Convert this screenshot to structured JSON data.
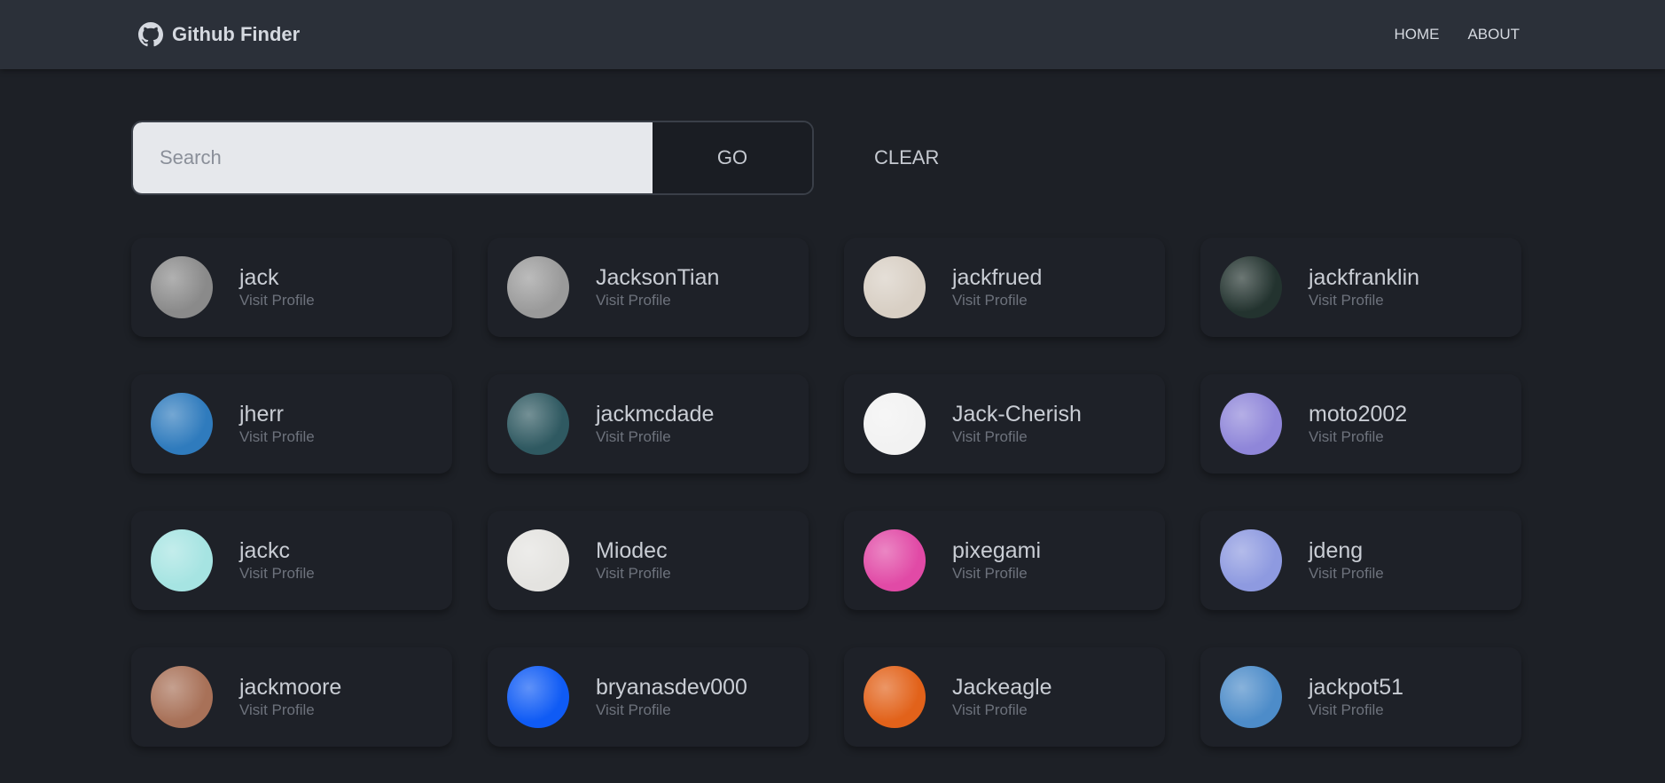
{
  "navbar": {
    "brand_icon": "github-icon",
    "brand_label": "Github Finder",
    "links": [
      {
        "label": "HOME"
      },
      {
        "label": "ABOUT"
      }
    ]
  },
  "search": {
    "placeholder": "Search",
    "value": "",
    "go_label": "GO",
    "clear_label": "CLEAR"
  },
  "users": [
    {
      "login": "jack",
      "link_label": "Visit Profile",
      "avatar_color": "#8a8a8a"
    },
    {
      "login": "JacksonTian",
      "link_label": "Visit Profile",
      "avatar_color": "#9a9a9a"
    },
    {
      "login": "jackfrued",
      "link_label": "Visit Profile",
      "avatar_color": "#d8cfc4"
    },
    {
      "login": "jackfranklin",
      "link_label": "Visit Profile",
      "avatar_color": "#23332f"
    },
    {
      "login": "jherr",
      "link_label": "Visit Profile",
      "avatar_color": "#2f7bbd"
    },
    {
      "login": "jackmcdade",
      "link_label": "Visit Profile",
      "avatar_color": "#2f5961"
    },
    {
      "login": "Jack-Cherish",
      "link_label": "Visit Profile",
      "avatar_color": "#f2f2f2"
    },
    {
      "login": "moto2002",
      "link_label": "Visit Profile",
      "avatar_color": "#8f86d9"
    },
    {
      "login": "jackc",
      "link_label": "Visit Profile",
      "avatar_color": "#a6e4e2"
    },
    {
      "login": "Miodec",
      "link_label": "Visit Profile",
      "avatar_color": "#e4e3e0"
    },
    {
      "login": "pixegami",
      "link_label": "Visit Profile",
      "avatar_color": "#e14aa6"
    },
    {
      "login": "jdeng",
      "link_label": "Visit Profile",
      "avatar_color": "#8e9ae0"
    },
    {
      "login": "jackmoore",
      "link_label": "Visit Profile",
      "avatar_color": "#a87158"
    },
    {
      "login": "bryanasdev000",
      "link_label": "Visit Profile",
      "avatar_color": "#0f5bf5"
    },
    {
      "login": "Jackeagle",
      "link_label": "Visit Profile",
      "avatar_color": "#e2621a"
    },
    {
      "login": "jackpot51",
      "link_label": "Visit Profile",
      "avatar_color": "#4d8cc9"
    }
  ]
}
